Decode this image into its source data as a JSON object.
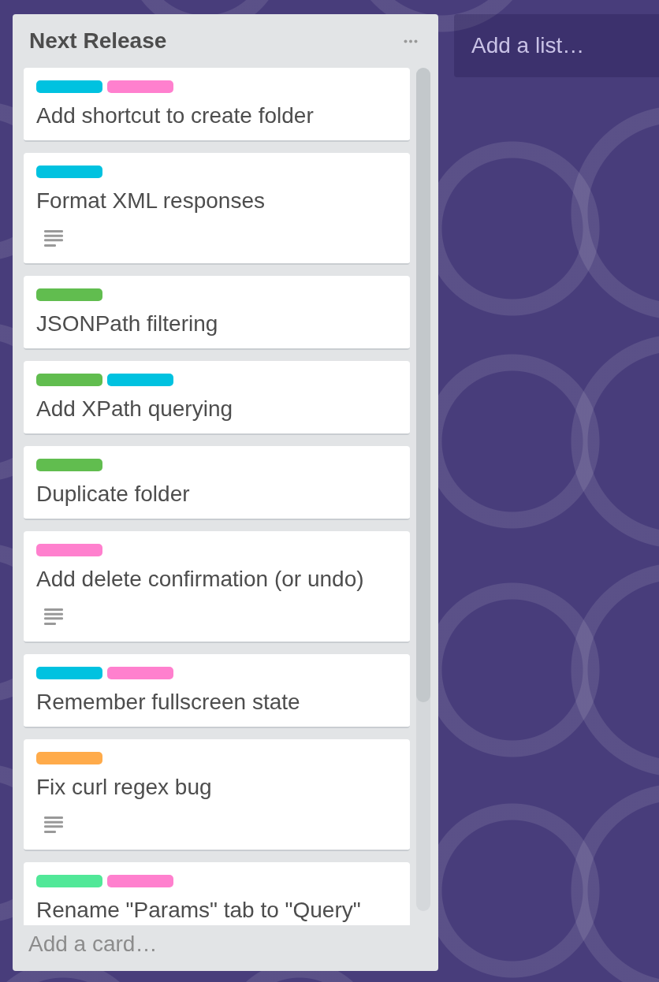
{
  "list": {
    "title": "Next Release",
    "cards": [
      {
        "labels": [
          {
            "color": "#00c2e0"
          },
          {
            "color": "#ff80ce"
          }
        ],
        "title": "Add shortcut to create folder",
        "description": false
      },
      {
        "labels": [
          {
            "color": "#00c2e0"
          }
        ],
        "title": "Format XML responses",
        "description": true
      },
      {
        "labels": [
          {
            "color": "#61bd4f"
          }
        ],
        "title": "JSONPath filtering",
        "description": false
      },
      {
        "labels": [
          {
            "color": "#61bd4f"
          },
          {
            "color": "#00c2e0"
          }
        ],
        "title": "Add XPath querying",
        "description": false
      },
      {
        "labels": [
          {
            "color": "#61bd4f"
          }
        ],
        "title": "Duplicate folder",
        "description": false
      },
      {
        "labels": [
          {
            "color": "#ff80ce"
          }
        ],
        "title": "Add delete confirmation (or undo)",
        "description": true
      },
      {
        "labels": [
          {
            "color": "#00c2e0"
          },
          {
            "color": "#ff80ce"
          }
        ],
        "title": "Remember fullscreen state",
        "description": false
      },
      {
        "labels": [
          {
            "color": "#ffab4a"
          }
        ],
        "title": "Fix curl regex bug",
        "description": true
      },
      {
        "labels": [
          {
            "color": "#51e898"
          },
          {
            "color": "#ff80ce"
          }
        ],
        "title": "Rename \"Params\" tab to \"Query\"",
        "description": false
      }
    ],
    "add_card": "Add a card…"
  },
  "add_list": "Add a list…"
}
